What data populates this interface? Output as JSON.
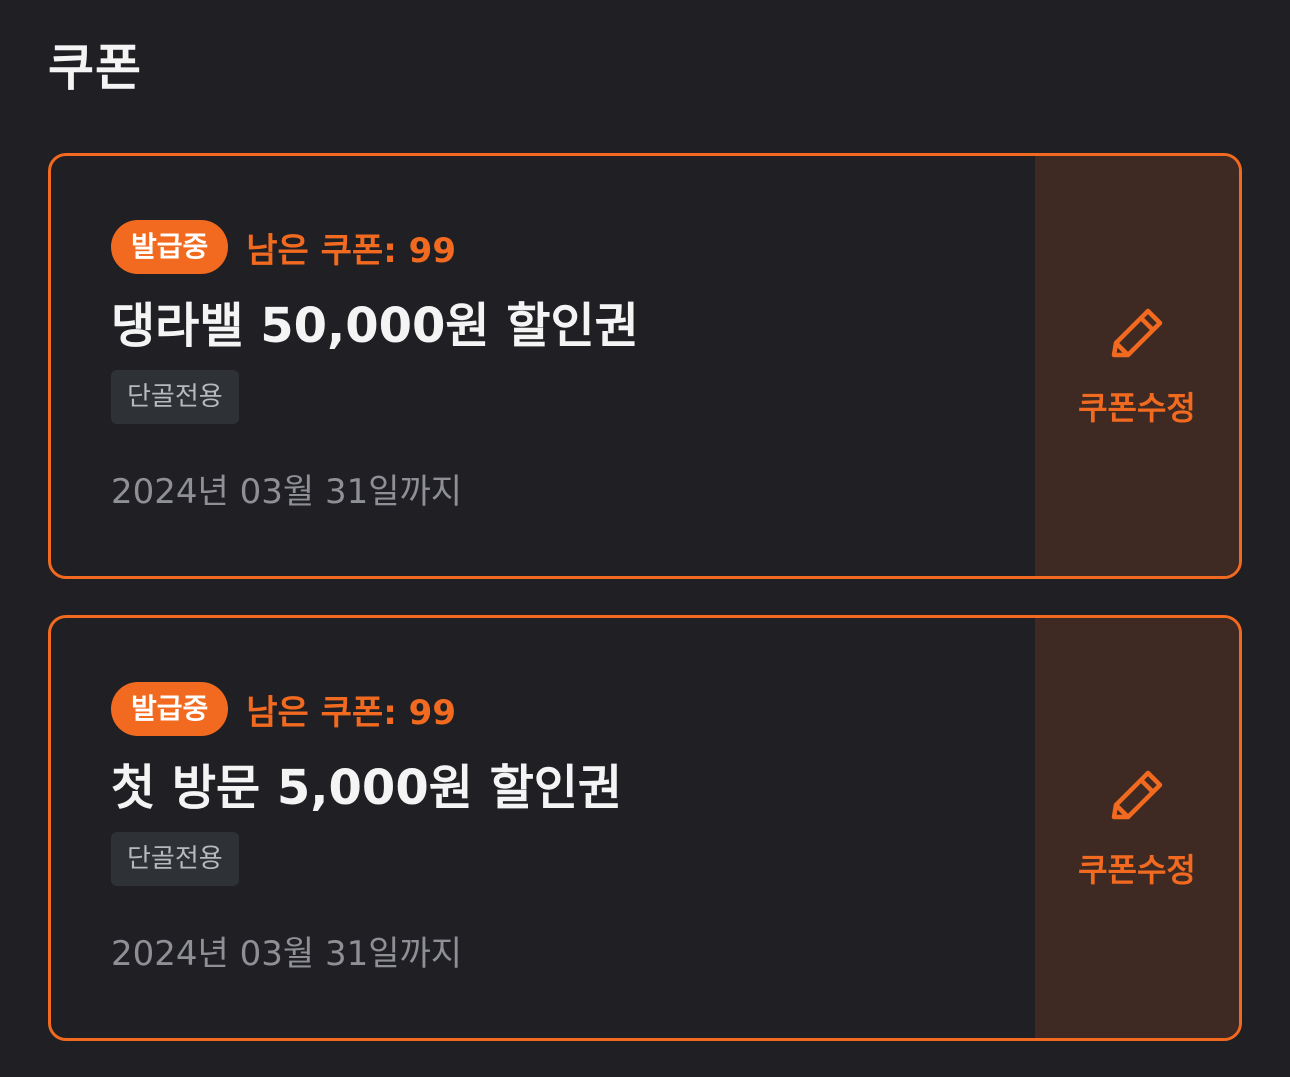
{
  "header": {
    "title": "쿠폰"
  },
  "coupons": [
    {
      "status": "발급중",
      "remaining": "남은 쿠폰: 99",
      "name": "댕라밸 50,000원 할인권",
      "tag": "단골전용",
      "expiry": "2024년 03월 31일까지",
      "edit_label": "쿠폰수정",
      "edit_icon": "pencil-icon"
    },
    {
      "status": "발급중",
      "remaining": "남은 쿠폰: 99",
      "name": "첫 방문 5,000원 할인권",
      "tag": "단골전용",
      "expiry": "2024년 03월 31일까지",
      "edit_label": "쿠폰수정",
      "edit_icon": "pencil-icon"
    }
  ],
  "colors": {
    "background": "#202024",
    "accent": "#f26a1f",
    "edit_panel": "#3e2a22",
    "tag_bg": "#2e3136"
  }
}
